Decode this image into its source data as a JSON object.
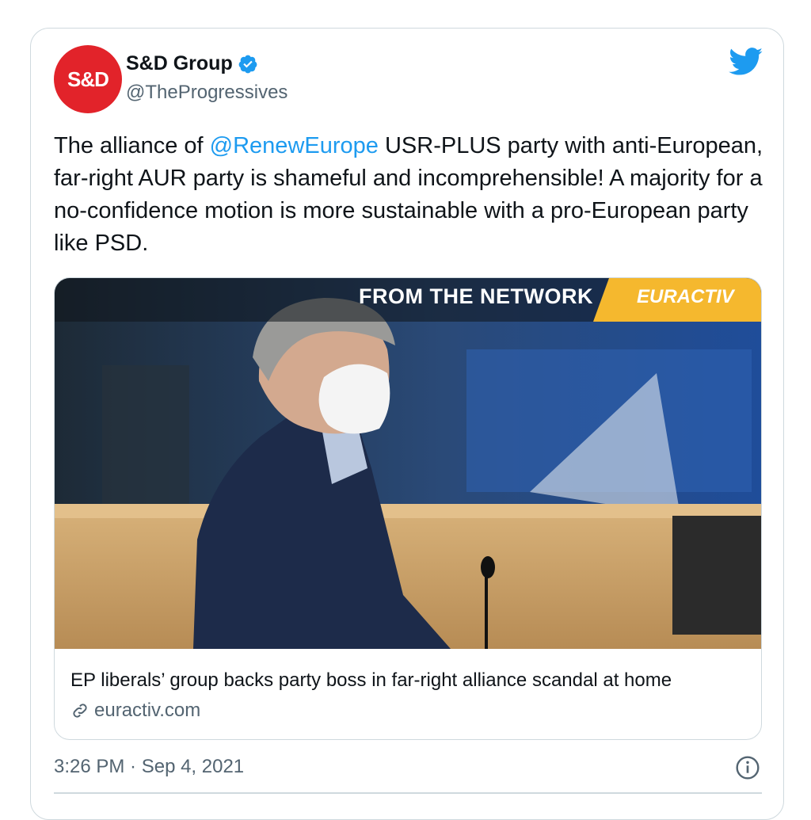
{
  "author": {
    "avatar_text": "S&D",
    "name": "S&D Group",
    "handle": "@TheProgressives",
    "verified_icon": "verified-badge-icon"
  },
  "brand_icon": "twitter-bird-icon",
  "tweet": {
    "text_before": "The alliance of ",
    "mention": "@RenewEurope",
    "text_after": " USR-PLUS party with anti-European, far-right AUR party is shameful and incomprehensible! A majority for a no-confidence motion is more sustainable with a pro-European party like PSD."
  },
  "link_card": {
    "banner_label": "FROM THE NETWORK",
    "banner_brand": "EURACTIV",
    "title": "EP liberals’ group backs party boss in far-right alliance scandal at home",
    "domain": "euractiv.com",
    "domain_icon": "link-icon"
  },
  "footer": {
    "timestamp": "3:26 PM · Sep 4, 2021",
    "info_icon": "info-icon"
  },
  "colors": {
    "accent": "#1d9bf0",
    "avatar_bg": "#e2232a",
    "banner_yellow": "#f5b82e"
  }
}
